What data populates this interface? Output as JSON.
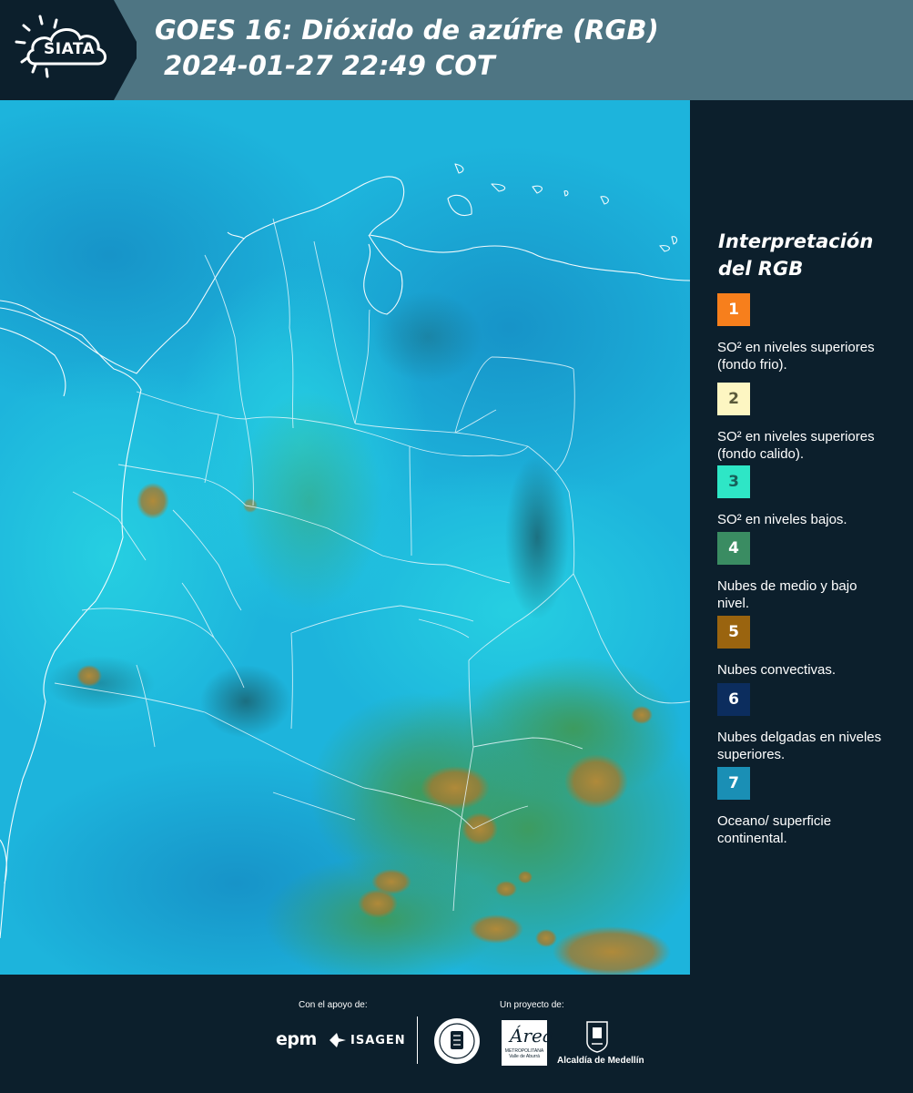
{
  "header": {
    "logo_text": "SIATA",
    "title_line1": "GOES 16: Dióxido de azúfre (RGB)",
    "title_line2": "2024-01-27 22:49 COT"
  },
  "legend": {
    "title": "Interpretación del RGB",
    "items": [
      {
        "number": "1",
        "label": "SO² en niveles superiores (fondo frio).",
        "color": "#f77f1c",
        "text_color": "#ffffff"
      },
      {
        "number": "2",
        "label": "SO² en niveles superiores (fondo calido).",
        "color": "#fdf6c2",
        "text_color": "#5a5a3a"
      },
      {
        "number": "3",
        "label": "SO² en niveles bajos.",
        "color": "#2ee6c6",
        "text_color": "#18605a"
      },
      {
        "number": "4",
        "label": "Nubes de medio y bajo nivel.",
        "color": "#3a8c62",
        "text_color": "#ffffff"
      },
      {
        "number": "5",
        "label": "Nubes convectivas.",
        "color": "#9a640f",
        "text_color": "#ffffff"
      },
      {
        "number": "6",
        "label": "Nubes delgadas en niveles superiores.",
        "color": "#0c2d5e",
        "text_color": "#ffffff"
      },
      {
        "number": "7",
        "label": "Oceano/ superficie continental.",
        "color": "#1a8fb5",
        "text_color": "#ffffff"
      }
    ]
  },
  "footer": {
    "support_label": "Con el apoyo de:",
    "project_label": "Un proyecto de:",
    "epm": "epm",
    "isagen": "ISAGEN",
    "amva_mark": "Área",
    "amva_small": "METROPOLITANA Valle de Aburrá",
    "alcaldia": "Alcaldía de Medellín"
  },
  "colors": {
    "header_bg": "#4e7583",
    "panel_bg": "#0c1f2c",
    "map_base": "#1fb7d8",
    "border_line": "#ffffff"
  }
}
